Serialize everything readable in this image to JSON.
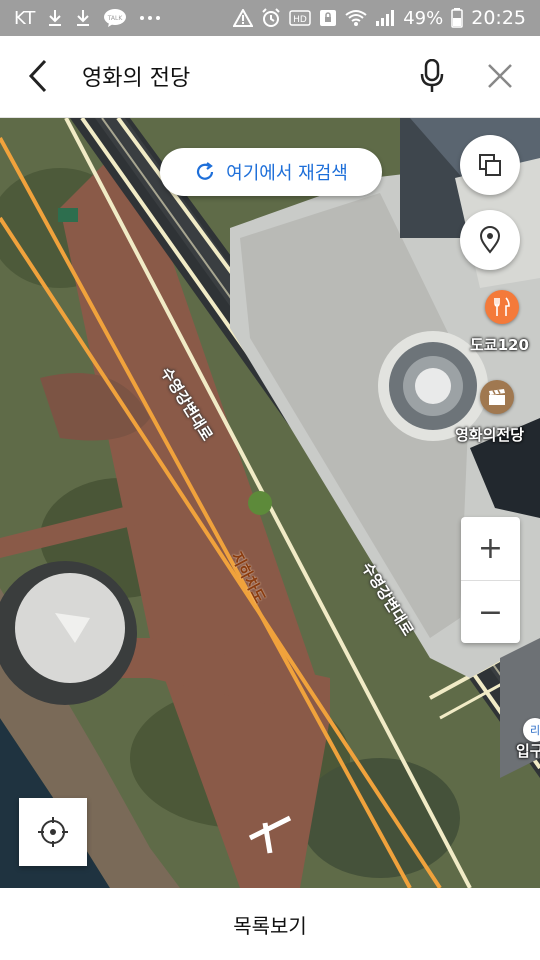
{
  "status_bar": {
    "carrier": "KT",
    "battery": "49%",
    "time": "20:25",
    "talk_badge": "TALK",
    "hd_badge": "HD",
    "left_icons": [
      "download-icon",
      "download-icon",
      "kakaotalk-icon",
      "more-dots-icon"
    ],
    "right_icons": [
      "warning-icon",
      "alarm-icon",
      "hd-icon",
      "sim-lock-icon",
      "wifi-icon",
      "signal-icon",
      "battery-icon"
    ]
  },
  "header": {
    "title": "영화의 전당",
    "back_icon": "chevron-left-icon",
    "mic_icon": "microphone-icon",
    "close_icon": "close-icon"
  },
  "map": {
    "research_label": "여기에서 재검색",
    "research_icon": "refresh-icon",
    "road_labels": {
      "road_upper": "수영강변대로",
      "road_lower": "수영강변대로",
      "tunnel": "지하차도"
    },
    "pois": [
      {
        "label": "도쿄120",
        "icon": "restaurant-icon",
        "color": "#f47a3a"
      },
      {
        "label": "영화의전당",
        "icon": "film-clapper-icon",
        "color": "#a07850"
      }
    ],
    "partial_label": "입구",
    "partial_badge": "리"
  },
  "controls": {
    "layer_icon": "layers-icon",
    "pin_icon": "location-pin-icon",
    "zoom_in": "+",
    "zoom_out": "−",
    "locate_icon": "crosshair-icon"
  },
  "bottom": {
    "list_view_label": "목록보기"
  }
}
